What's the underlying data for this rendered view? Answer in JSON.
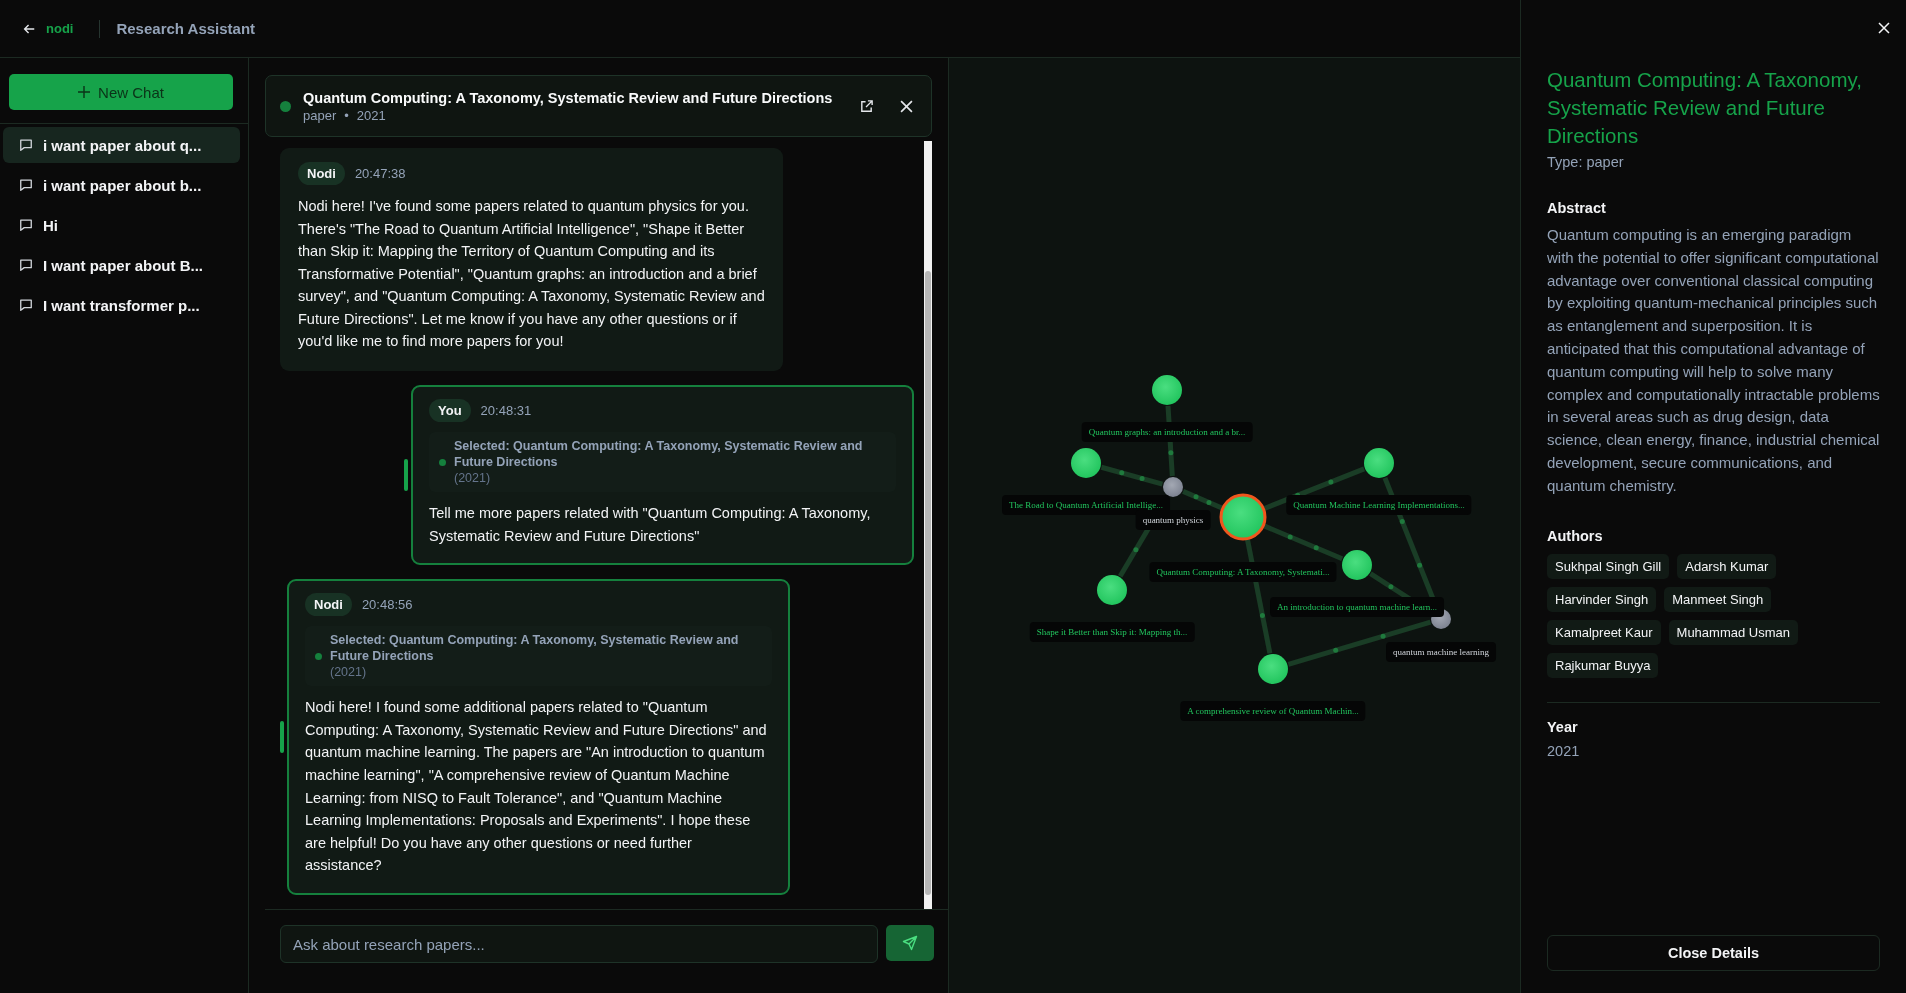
{
  "header": {
    "back_label": "nodi",
    "title": "Research Assistant"
  },
  "sidebar": {
    "new_chat": "New Chat",
    "items": [
      {
        "label": "i want paper about q...",
        "selected": true
      },
      {
        "label": "i want paper about b...",
        "selected": false
      },
      {
        "label": "Hi",
        "selected": false
      },
      {
        "label": "I want paper about B...",
        "selected": false
      },
      {
        "label": "I want transformer p...",
        "selected": false
      }
    ]
  },
  "selected_paper": {
    "title": "Quantum Computing: A Taxonomy, Systematic Review and Future Directions",
    "type": "paper",
    "separator": "•",
    "year": "2021"
  },
  "messages": [
    {
      "kind": "assistant",
      "sender": "Nodi",
      "time": "20:47:38",
      "highlighted": false,
      "text": "Nodi here! I've found some papers related to quantum physics for you. There's \"The Road to Quantum Artificial Intelligence\", \"Shape it Better than Skip it: Mapping the Territory of Quantum Computing and its Transformative Potential\", \"Quantum graphs: an introduction and a brief survey\", and \"Quantum Computing: A Taxonomy, Systematic Review and Future Directions\". Let me know if you have any other questions or if you'd like me to find more papers for you!"
    },
    {
      "kind": "user",
      "sender": "You",
      "time": "20:48:31",
      "highlighted": true,
      "context": {
        "label": "Selected: Quantum Computing: A Taxonomy, Systematic Review and Future Directions",
        "year": "(2021)"
      },
      "text": "Tell me more papers related with \"Quantum Computing: A Taxonomy, Systematic Review and Future Directions\""
    },
    {
      "kind": "assistant",
      "sender": "Nodi",
      "time": "20:48:56",
      "highlighted": true,
      "context": {
        "label": "Selected: Quantum Computing: A Taxonomy, Systematic Review and Future Directions",
        "year": "(2021)"
      },
      "text": "Nodi here! I found some additional papers related to \"Quantum Computing: A Taxonomy, Systematic Review and Future Directions\" and quantum machine learning. The papers are \"An introduction to quantum machine learning\", \"A comprehensive review of Quantum Machine Learning: from NISQ to Fault Tolerance\", and \"Quantum Machine Learning Implementations: Proposals and Experiments\". I hope these are helpful! Do you have any other questions or need further assistance?"
    }
  ],
  "input": {
    "placeholder": "Ask about research papers..."
  },
  "graph": {
    "nodes": [
      {
        "label": "Quantum graphs: an introduction and a br...",
        "kind": "paper",
        "selected": false
      },
      {
        "label": "The Road to Quantum Artificial Intellige...",
        "kind": "paper",
        "selected": false
      },
      {
        "label": "Quantum Machine Learning Implementations...",
        "kind": "paper",
        "selected": false
      },
      {
        "label": "quantum physics",
        "kind": "topic",
        "selected": false
      },
      {
        "label": "Quantum Computing: A Taxonomy, Systemati...",
        "kind": "paper",
        "selected": true
      },
      {
        "label": "An introduction to quantum machine learn...",
        "kind": "paper",
        "selected": false
      },
      {
        "label": "Shape it Better than Skip it: Mapping th...",
        "kind": "paper",
        "selected": false
      },
      {
        "label": "quantum machine learning",
        "kind": "topic",
        "selected": false
      },
      {
        "label": "A comprehensive review of Quantum Machin...",
        "kind": "paper",
        "selected": false
      }
    ]
  },
  "details": {
    "title": "Quantum Computing: A Taxonomy, Systematic Review and Future Directions",
    "type_line": "Type: paper",
    "abstract_heading": "Abstract",
    "abstract": "Quantum computing is an emerging paradigm with the potential to offer significant computational advantage over conventional classical computing by exploiting quantum-mechanical principles such as entanglement and superposition. It is anticipated that this computational advantage of quantum computing will help to solve many complex and computationally intractable problems in several areas such as drug design, data science, clean energy, finance, industrial chemical development, secure communications, and quantum chemistry.",
    "authors_heading": "Authors",
    "authors": [
      "Sukhpal Singh Gill",
      "Adarsh Kumar",
      "Harvinder Singh",
      "Manmeet Singh",
      "Kamalpreet Kaur",
      "Muhammad Usman",
      "Rajkumar Buyya"
    ],
    "year_heading": "Year",
    "year": "2021",
    "close_button": "Close Details"
  }
}
